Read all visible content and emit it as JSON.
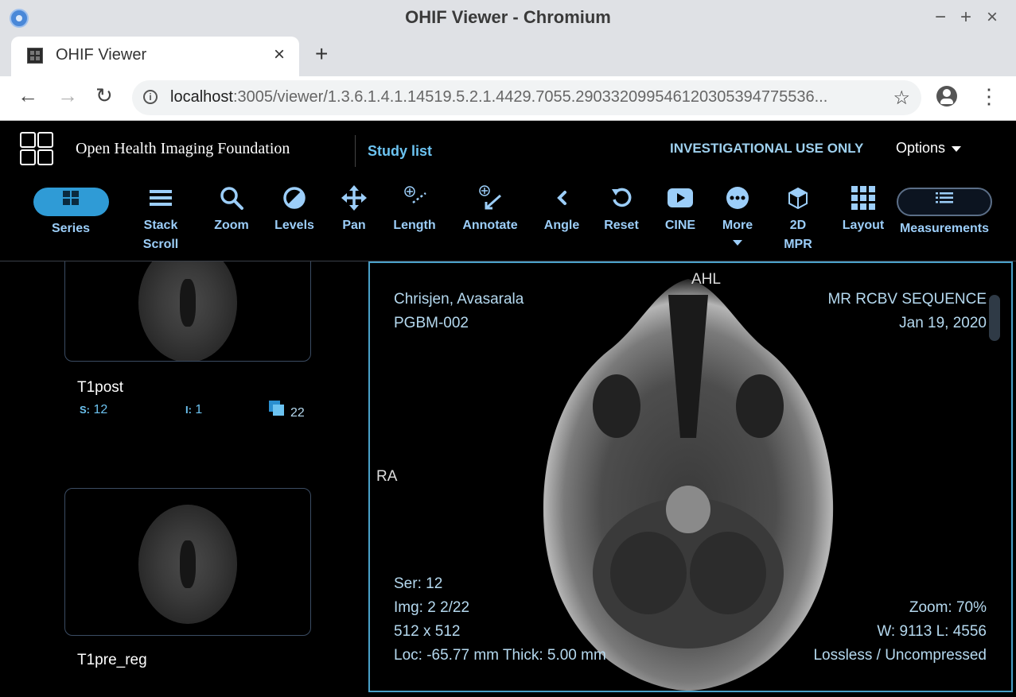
{
  "window": {
    "title": "OHIF Viewer - Chromium",
    "controls": [
      "−",
      "+",
      "×"
    ]
  },
  "tab": {
    "title": "OHIF Viewer",
    "close": "×",
    "new_tab": "+"
  },
  "address": {
    "host": "localhost",
    "rest": ":3005/viewer/1.3.6.1.4.1.14519.5.2.1.4429.7055.290332099546120305394775536..."
  },
  "header": {
    "brand": "Open Health Imaging Foundation",
    "study_list": "Study list",
    "notice": "INVESTIGATIONAL USE ONLY",
    "options": "Options"
  },
  "toolbar": {
    "series": "Series",
    "stack_scroll_1": "Stack",
    "stack_scroll_2": "Scroll",
    "zoom": "Zoom",
    "levels": "Levels",
    "pan": "Pan",
    "length": "Length",
    "annotate": "Annotate",
    "angle": "Angle",
    "reset": "Reset",
    "cine": "CINE",
    "more": "More",
    "mpr_1": "2D",
    "mpr_2": "MPR",
    "layout": "Layout",
    "measurements": "Measurements"
  },
  "series_list": [
    {
      "name": "T1post",
      "s_label": "S:",
      "s_value": "12",
      "i_label": "I:",
      "i_value": "1",
      "count": "22"
    },
    {
      "name": "T1pre_reg"
    }
  ],
  "viewport": {
    "orient_top": "AHL",
    "orient_left": "RA",
    "patient_name": "Chrisjen, Avasarala",
    "patient_id": "PGBM-002",
    "description": "MR RCBV SEQUENCE",
    "date": "Jan 19, 2020",
    "ser": "Ser: 12",
    "img": "Img: 2 2/22",
    "size": "512 x 512",
    "loc": "Loc: -65.77 mm Thick: 5.00 mm",
    "zoom": "Zoom: 70%",
    "wl": "W: 9113 L: 4556",
    "compression": "Lossless / Uncompressed"
  }
}
